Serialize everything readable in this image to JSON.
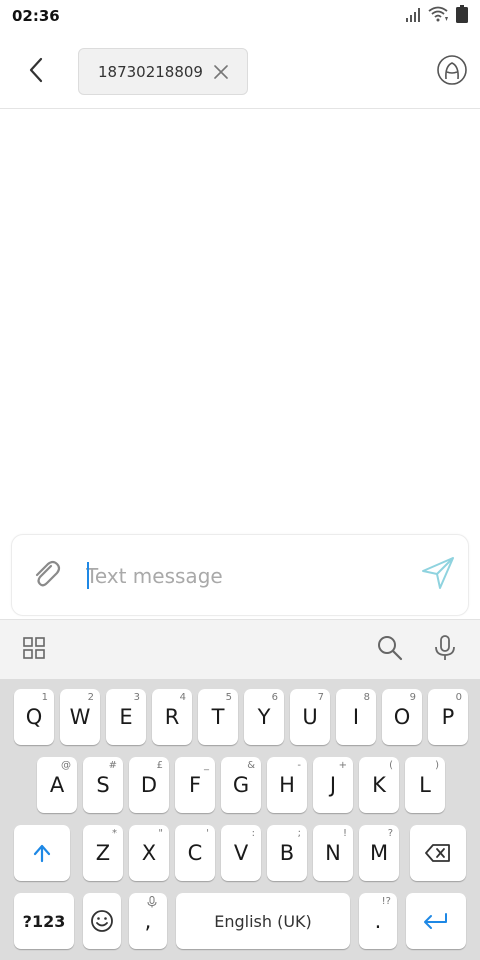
{
  "status_bar": {
    "time": "02:36"
  },
  "header": {
    "recipient": "18730218809"
  },
  "composer": {
    "placeholder": "Text message"
  },
  "keyboard": {
    "row1": [
      {
        "label": "Q",
        "hint": "1"
      },
      {
        "label": "W",
        "hint": "2"
      },
      {
        "label": "E",
        "hint": "3"
      },
      {
        "label": "R",
        "hint": "4"
      },
      {
        "label": "T",
        "hint": "5"
      },
      {
        "label": "Y",
        "hint": "6"
      },
      {
        "label": "U",
        "hint": "7"
      },
      {
        "label": "I",
        "hint": "8"
      },
      {
        "label": "O",
        "hint": "9"
      },
      {
        "label": "P",
        "hint": "0"
      }
    ],
    "row2": [
      {
        "label": "A",
        "hint": "@"
      },
      {
        "label": "S",
        "hint": "#"
      },
      {
        "label": "D",
        "hint": "£"
      },
      {
        "label": "F",
        "hint": "_"
      },
      {
        "label": "G",
        "hint": "&"
      },
      {
        "label": "H",
        "hint": "-"
      },
      {
        "label": "J",
        "hint": "+"
      },
      {
        "label": "K",
        "hint": "("
      },
      {
        "label": "L",
        "hint": ")"
      }
    ],
    "row3": [
      {
        "label": "Z",
        "hint": "*"
      },
      {
        "label": "X",
        "hint": "\""
      },
      {
        "label": "C",
        "hint": "'"
      },
      {
        "label": "V",
        "hint": ":"
      },
      {
        "label": "B",
        "hint": ";"
      },
      {
        "label": "N",
        "hint": "!"
      },
      {
        "label": "M",
        "hint": "?"
      }
    ],
    "symbols_label": "?123",
    "comma_label": ",",
    "space_label": "English (UK)",
    "period_label": ".",
    "period_hint": "!?"
  },
  "colors": {
    "accent": "#1e88e5",
    "send_icon": "#8fd3df",
    "keyboard_bg": "#dcdcdc"
  }
}
